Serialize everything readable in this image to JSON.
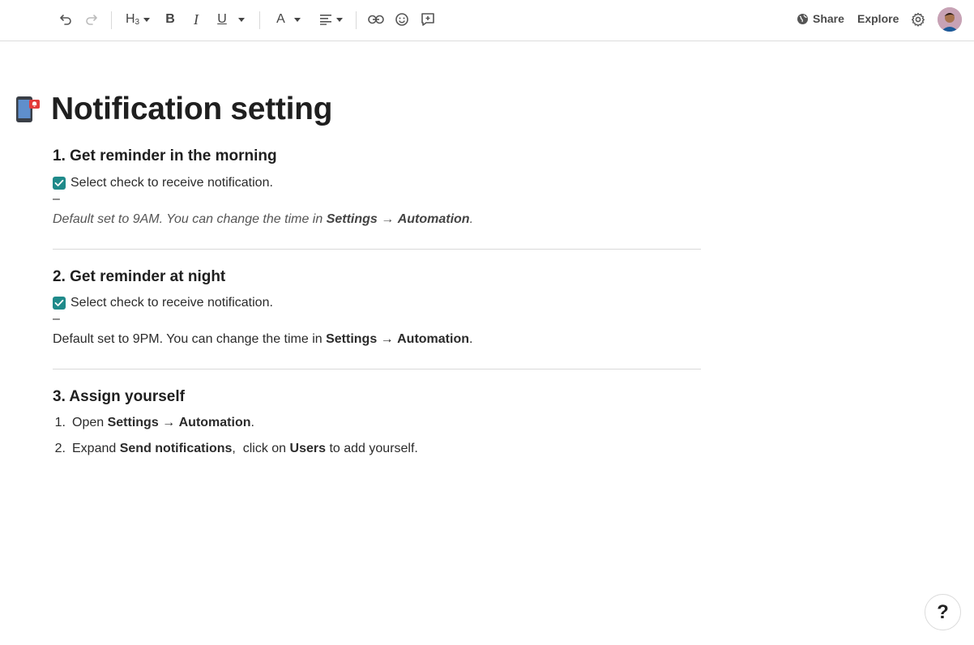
{
  "toolbar": {
    "heading_label": "H",
    "heading_sub": "3",
    "bold_label": "B",
    "italic_label": "I",
    "underline_label": "U",
    "font_color_label": "A",
    "share_label": "Share",
    "explore_label": "Explore"
  },
  "document": {
    "title": "Notification setting",
    "sections": [
      {
        "heading": "1. Get reminder in the morning",
        "checkbox_label": "Select check to receive notification.",
        "dash": "–",
        "note_prefix": "Default set to 9AM. You can change the time in ",
        "note_bold1": "Settings",
        "note_arrow": " → ",
        "note_bold2": "Automation",
        "note_suffix": "."
      },
      {
        "heading": "2. Get reminder at night",
        "checkbox_label": "Select check to receive notification.",
        "dash": "–",
        "note_prefix": "Default set to 9PM. You can change the time in ",
        "note_bold1": "Settings",
        "note_arrow": " → ",
        "note_bold2": "Automation",
        "note_suffix": "."
      },
      {
        "heading": "3. Assign yourself",
        "steps": [
          {
            "num": "1.",
            "t1": "Open ",
            "b1": "Settings",
            "t2": " → ",
            "b2": "Automation",
            "t3": "."
          },
          {
            "num": "2.",
            "t1": "Expand ",
            "b1": "Send notifications",
            "t2": ",  click on ",
            "b2": "Users",
            "t3": " to add yourself."
          }
        ]
      }
    ]
  },
  "help_label": "?",
  "colors": {
    "checkbox": "#1f8a8a",
    "text": "#1f1f1f",
    "rule": "#d9d9d9"
  }
}
